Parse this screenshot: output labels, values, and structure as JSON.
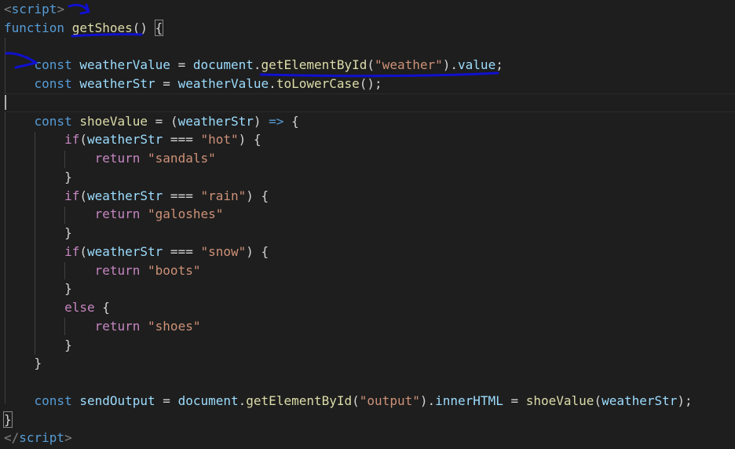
{
  "editor": {
    "background": "#1e1e1e",
    "line_highlight": "#2a2a2a",
    "annotation_color": "#1010d0"
  },
  "code": {
    "l1": {
      "lt": "<",
      "tag": "script",
      "gt": ">"
    },
    "l2": {
      "kw": "function",
      "sp": " ",
      "fn": "getShoes",
      "rest": "() ",
      "brace": "{"
    },
    "l4": {
      "indent": "    ",
      "kw": "const",
      "sp": " ",
      "var": "weatherValue",
      "eq": " = ",
      "obj": "document",
      "dot": ".",
      "fn": "getElementById",
      "open": "(",
      "str": "\"weather\"",
      "close": ")",
      "dot2": ".",
      "prop": "value",
      "semi": ";"
    },
    "l5": {
      "indent": "    ",
      "kw": "const",
      "sp": " ",
      "var": "weatherStr",
      "eq": " = ",
      "obj": "weatherValue",
      "dot": ".",
      "fn": "toLowerCase",
      "rest": "();"
    },
    "l7": {
      "indent": "    ",
      "kw": "const",
      "sp": " ",
      "fn": "shoeValue",
      "eq": " = (",
      "param": "weatherStr",
      "close": ") ",
      "arrow": "=>",
      "brace": " {"
    },
    "l8": {
      "indent": "        ",
      "ctrl": "if",
      "open": "(",
      "var": "weatherStr",
      "op": " === ",
      "str": "\"hot\"",
      "close": ") {"
    },
    "l9": {
      "indent": "            ",
      "ctrl": "return",
      "sp": " ",
      "str": "\"sandals\""
    },
    "l10": {
      "indent": "        ",
      "pun": "}"
    },
    "l11": {
      "indent": "        ",
      "ctrl": "if",
      "open": "(",
      "var": "weatherStr",
      "op": " === ",
      "str": "\"rain\"",
      "close": ") {"
    },
    "l12": {
      "indent": "            ",
      "ctrl": "return",
      "sp": " ",
      "str": "\"galoshes\""
    },
    "l13": {
      "indent": "        ",
      "pun": "}"
    },
    "l14": {
      "indent": "        ",
      "ctrl": "if",
      "open": "(",
      "var": "weatherStr",
      "op": " === ",
      "str": "\"snow\"",
      "close": ") {"
    },
    "l15": {
      "indent": "            ",
      "ctrl": "return",
      "sp": " ",
      "str": "\"boots\""
    },
    "l16": {
      "indent": "        ",
      "pun": "}"
    },
    "l17": {
      "indent": "        ",
      "ctrl": "else",
      "rest": " {"
    },
    "l18": {
      "indent": "            ",
      "ctrl": "return",
      "sp": " ",
      "str": "\"shoes\""
    },
    "l19": {
      "indent": "        ",
      "pun": "}"
    },
    "l20": {
      "indent": "    ",
      "pun": "}"
    },
    "l22": {
      "indent": "    ",
      "kw": "const",
      "sp": " ",
      "var": "sendOutput",
      "eq": " = ",
      "obj": "document",
      "dot": ".",
      "fn": "getElementById",
      "open": "(",
      "str": "\"output\"",
      "close": ")",
      "dot2": ".",
      "prop": "innerHTML",
      "eq2": " = ",
      "fn2": "shoeValue",
      "open2": "(",
      "arg": "weatherStr",
      "close2": ");"
    },
    "l23": {
      "brace": "}"
    },
    "l24": {
      "lt": "</",
      "tag": "script",
      "gt": ">"
    }
  }
}
